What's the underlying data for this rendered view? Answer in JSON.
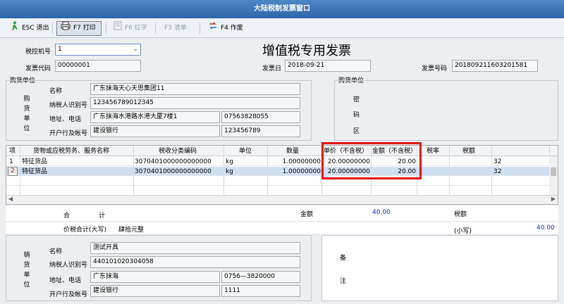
{
  "window": {
    "title": "大陆税制发票窗口"
  },
  "toolbar": {
    "esc": "ESC 退出",
    "f7": "F7 打印",
    "f6": "F6 红字",
    "f3": "F3 清单",
    "f4": "F4 作废"
  },
  "invoice": {
    "heading": "增值税专用发票",
    "machine_label": "税控机号",
    "machine_value": "1",
    "code_label": "发票代码",
    "code_value": "00000001",
    "date_label": "发票日",
    "date_value": "2018-09-21",
    "number_label": "发票号码",
    "number_value": "201809211603201581"
  },
  "buyer": {
    "group_label": "购货单位",
    "side_label": [
      "购",
      "货",
      "单",
      "位"
    ],
    "name_label": "名称",
    "name_value": "广东抹海天心天思集团11",
    "taxid_label": "纳税人识别号",
    "taxid_value": "123456789012345",
    "addr_label": "地址、电话",
    "addr_value": "广东抹海水港路水港大厦7楼1",
    "phone_value": "07563828055",
    "bank_label": "开户行及帐号",
    "bank_value": "建设银行",
    "account_value": "123456789"
  },
  "cipher": {
    "group_label": "购货单位",
    "chars": [
      "密",
      "码",
      "区"
    ]
  },
  "table": {
    "headers": [
      "项",
      "货物或应税劳务、服务名称",
      "税收分类编码",
      "单位",
      "数量",
      "单价（不含税）",
      "金额（不含税）",
      "税率",
      "税额",
      ""
    ],
    "rows": [
      [
        "1",
        "特征货品",
        "3070401000000000000",
        "kg",
        "1.00000000",
        "20.00000000",
        "20.00",
        "",
        "",
        "32"
      ],
      [
        "2",
        "特征货品",
        "3070401000000000000",
        "kg",
        "1.00000000",
        "20.00000000",
        "20.00",
        "",
        "",
        "32"
      ]
    ]
  },
  "totals": {
    "he": "合",
    "ji": "计",
    "amount_label": "金额",
    "amount_value": "40.00",
    "tax_label": "税额",
    "price_tax_label": "价税合计(大写)",
    "price_tax_words": "肆拾元整",
    "small_label": "(小写)",
    "small_value": "40.00"
  },
  "seller": {
    "side_label": [
      "销",
      "货",
      "单",
      "位"
    ],
    "name_label": "名称",
    "name_value": "测试开具",
    "taxid_label": "纳税人识别号",
    "taxid_value": "440101020304058",
    "addr_label": "地址、电话",
    "addr_value": "广东抹海",
    "phone_value": "0756—3820000",
    "bank_label": "开户行及帐号",
    "bank_value": "建设银行",
    "account_value": "1111"
  },
  "remarks": {
    "chars": [
      "备",
      "注"
    ]
  },
  "colors": {
    "highlight": "#e0141b",
    "amount_blue": "#1d2fb8",
    "title_bar": "#3a72b5"
  },
  "icons": [
    "exit-person-icon",
    "printer-icon",
    "red-invoice-icon",
    "list-icon",
    "void-icon"
  ]
}
